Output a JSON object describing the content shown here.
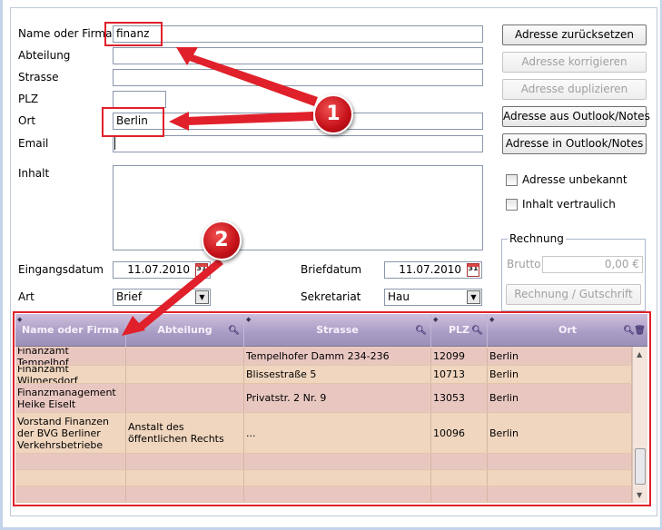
{
  "form": {
    "name_label": "Name oder Firma",
    "name_value": "finanz",
    "abteilung_label": "Abteilung",
    "abteilung_value": "",
    "strasse_label": "Strasse",
    "strasse_value": "",
    "plz_label": "PLZ",
    "plz_value": "",
    "ort_label": "Ort",
    "ort_value": "Berlin",
    "email_label": "Email",
    "email_value": "",
    "inhalt_label": "Inhalt",
    "inhalt_value": "",
    "eingangsdatum_label": "Eingangsdatum",
    "eingangsdatum_value": "11.07.2010",
    "briefdatum_label": "Briefdatum",
    "briefdatum_value": "11.07.2010",
    "calendar_glyph": "31",
    "art_label": "Art",
    "art_value": "Brief",
    "sekretariat_label": "Sekretariat",
    "sekretariat_value": "Hau"
  },
  "buttons": {
    "reset": "Adresse zurücksetzen",
    "korrigieren": "Adresse korrigieren",
    "duplizieren": "Adresse duplizieren",
    "from_outlook": "Adresse aus Outlook/Notes",
    "to_outlook": "Adresse in Outlook/Notes",
    "rechnung": "Rechnung / Gutschrift"
  },
  "options": {
    "unbekannt": "Adresse unbekannt",
    "vertraulich": "Inhalt vertraulich"
  },
  "rechnung": {
    "title": "Rechnung",
    "brutto_label": "Brutto",
    "brutto_value": "0,00 €"
  },
  "grid": {
    "columns": [
      "Name oder Firma",
      "Abteilung",
      "Strasse",
      "PLZ",
      "Ort"
    ],
    "rows": [
      [
        "Finanzamt Tempelhof",
        "",
        "Tempelhofer Damm 234-236",
        "12099",
        "Berlin"
      ],
      [
        "Finanzamt Wilmersdorf",
        "",
        "Blissestraße 5",
        "10713",
        "Berlin"
      ],
      [
        "Finanzmanagement Heike Eiselt",
        "",
        "Privatstr. 2 Nr. 9",
        "13053",
        "Berlin"
      ],
      [
        "Vorstand Finanzen der BVG Berliner Verkehrsbetriebe",
        "Anstalt des öffentlichen Rechts",
        "...",
        "10096",
        "Berlin"
      ]
    ]
  },
  "callouts": {
    "one": "1",
    "two": "2",
    "color": "#e0202a"
  },
  "icons": {
    "search": "search-icon",
    "calendar": "calendar-icon",
    "dropdown": "chevron-down-icon",
    "trash": "trash-icon"
  }
}
